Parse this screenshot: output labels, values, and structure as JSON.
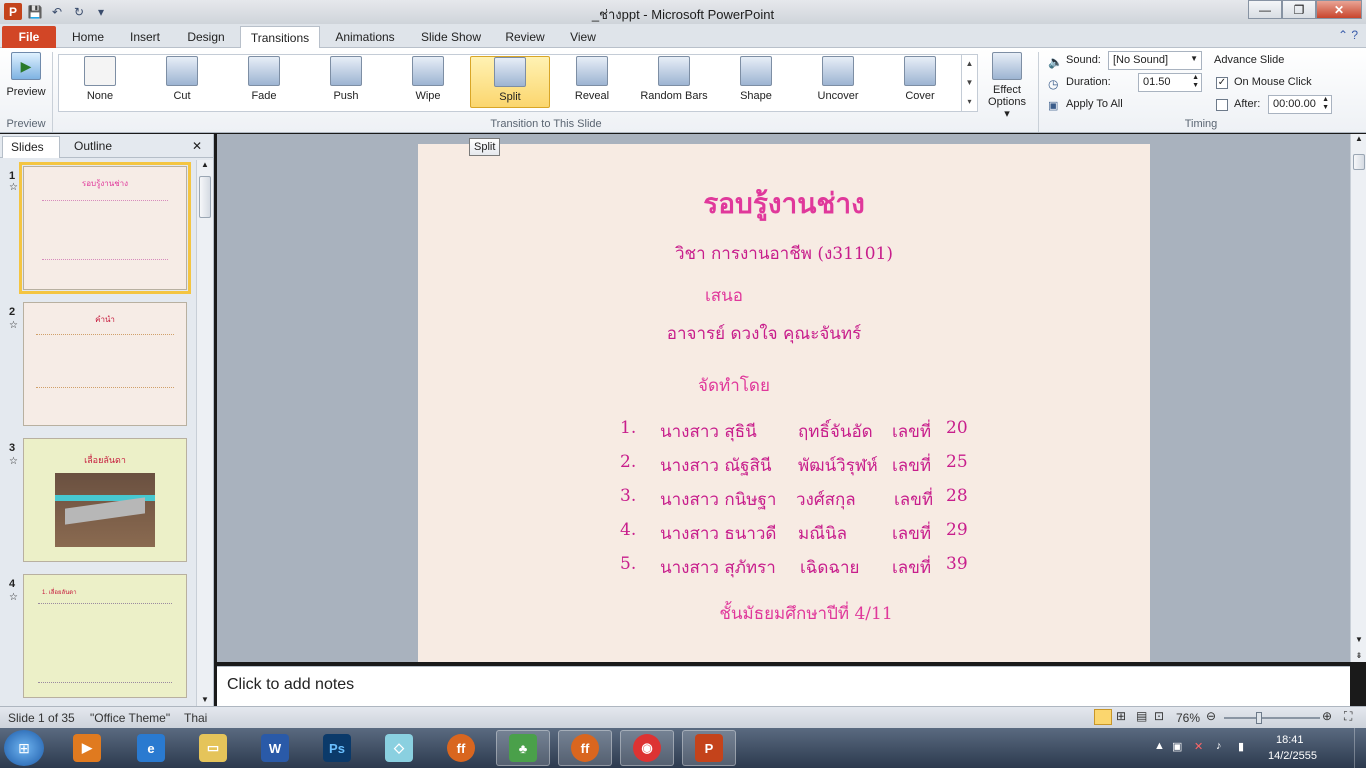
{
  "window": {
    "title": "_ช่างppt - Microsoft PowerPoint",
    "app_icon": "P"
  },
  "qat": {
    "save": "💾",
    "undo": "↶",
    "redo": "↻",
    "more": "▾"
  },
  "tabs": [
    {
      "label": "File"
    },
    {
      "label": "Home"
    },
    {
      "label": "Insert"
    },
    {
      "label": "Design"
    },
    {
      "label": "Transitions"
    },
    {
      "label": "Animations"
    },
    {
      "label": "Slide Show"
    },
    {
      "label": "Review"
    },
    {
      "label": "View"
    }
  ],
  "ribbon": {
    "preview": {
      "label": "Preview",
      "group": "Preview"
    },
    "transitions": [
      {
        "label": "None"
      },
      {
        "label": "Cut"
      },
      {
        "label": "Fade"
      },
      {
        "label": "Push"
      },
      {
        "label": "Wipe"
      },
      {
        "label": "Split"
      },
      {
        "label": "Reveal"
      },
      {
        "label": "Random Bars"
      },
      {
        "label": "Shape"
      },
      {
        "label": "Uncover"
      },
      {
        "label": "Cover"
      }
    ],
    "selected_transition": "Split",
    "effect_options": {
      "line1": "Effect",
      "line2": "Options ▾"
    },
    "transition_group": "Transition to This Slide",
    "timing": {
      "sound_label": "Sound:",
      "sound_value": "[No Sound]",
      "duration_label": "Duration:",
      "duration_value": "01.50",
      "apply_all": "Apply To All",
      "advance_title": "Advance Slide",
      "on_mouse_click": "On Mouse Click",
      "on_mouse_checked": true,
      "after_label": "After:",
      "after_value": "00:00.00",
      "after_checked": false,
      "group": "Timing"
    }
  },
  "tooltip": "Split",
  "pane": {
    "tab_slides": "Slides",
    "tab_outline": "Outline",
    "close": "✕",
    "slides": [
      {
        "num": "1",
        "heading": "รอบรู้งานช่าง"
      },
      {
        "num": "2",
        "heading": "คำนำ"
      },
      {
        "num": "3",
        "heading": "เลื่อยลันดา"
      },
      {
        "num": "4",
        "heading": "1. เลื่อยลันดา"
      }
    ]
  },
  "slide": {
    "title": "รอบรู้งานช่าง",
    "subject": "วิชา การงานอาชีพ (ง31101)",
    "present": "เสนอ",
    "teacher": "อาจารย์ ดวงใจ   คุณะจันทร์",
    "made_by": "จัดทำโดย",
    "members": [
      {
        "no": "1.",
        "name": "นางสาว สุธินี",
        "surname": "ฤทธิ์จันอัด",
        "num_label": "เลขที่",
        "num": "20"
      },
      {
        "no": "2.",
        "name": "นางสาว ณัฐสินี",
        "surname": "พัฒน์วิรุฬห์",
        "num_label": "เลขที่",
        "num": "25"
      },
      {
        "no": "3.",
        "name": "นางสาว กนิษฐา",
        "surname": "วงศ์สกุล",
        "num_label": "เลขที่",
        "num": "28"
      },
      {
        "no": "4.",
        "name": "นางสาว ธนาวดี",
        "surname": "มณีนิล",
        "num_label": "เลขที่",
        "num": "29"
      },
      {
        "no": "5.",
        "name": "นางสาว สุภัทรา",
        "surname": "เฉิดฉาย",
        "num_label": "เลขที่",
        "num": "39"
      }
    ],
    "grade": "ชั้นมัธยมศึกษาปีที่ 4/11"
  },
  "notes_placeholder": "Click to add notes",
  "status": {
    "slide": "Slide 1 of 35",
    "theme": "\"Office Theme\"",
    "lang": "Thai",
    "zoom": "76%"
  },
  "tray": {
    "time": "18:41",
    "date": "14/2/2555"
  },
  "colors": {
    "slide_text": "#e0389b",
    "file_tab": "#d24626",
    "selected": "#fbd66e"
  }
}
